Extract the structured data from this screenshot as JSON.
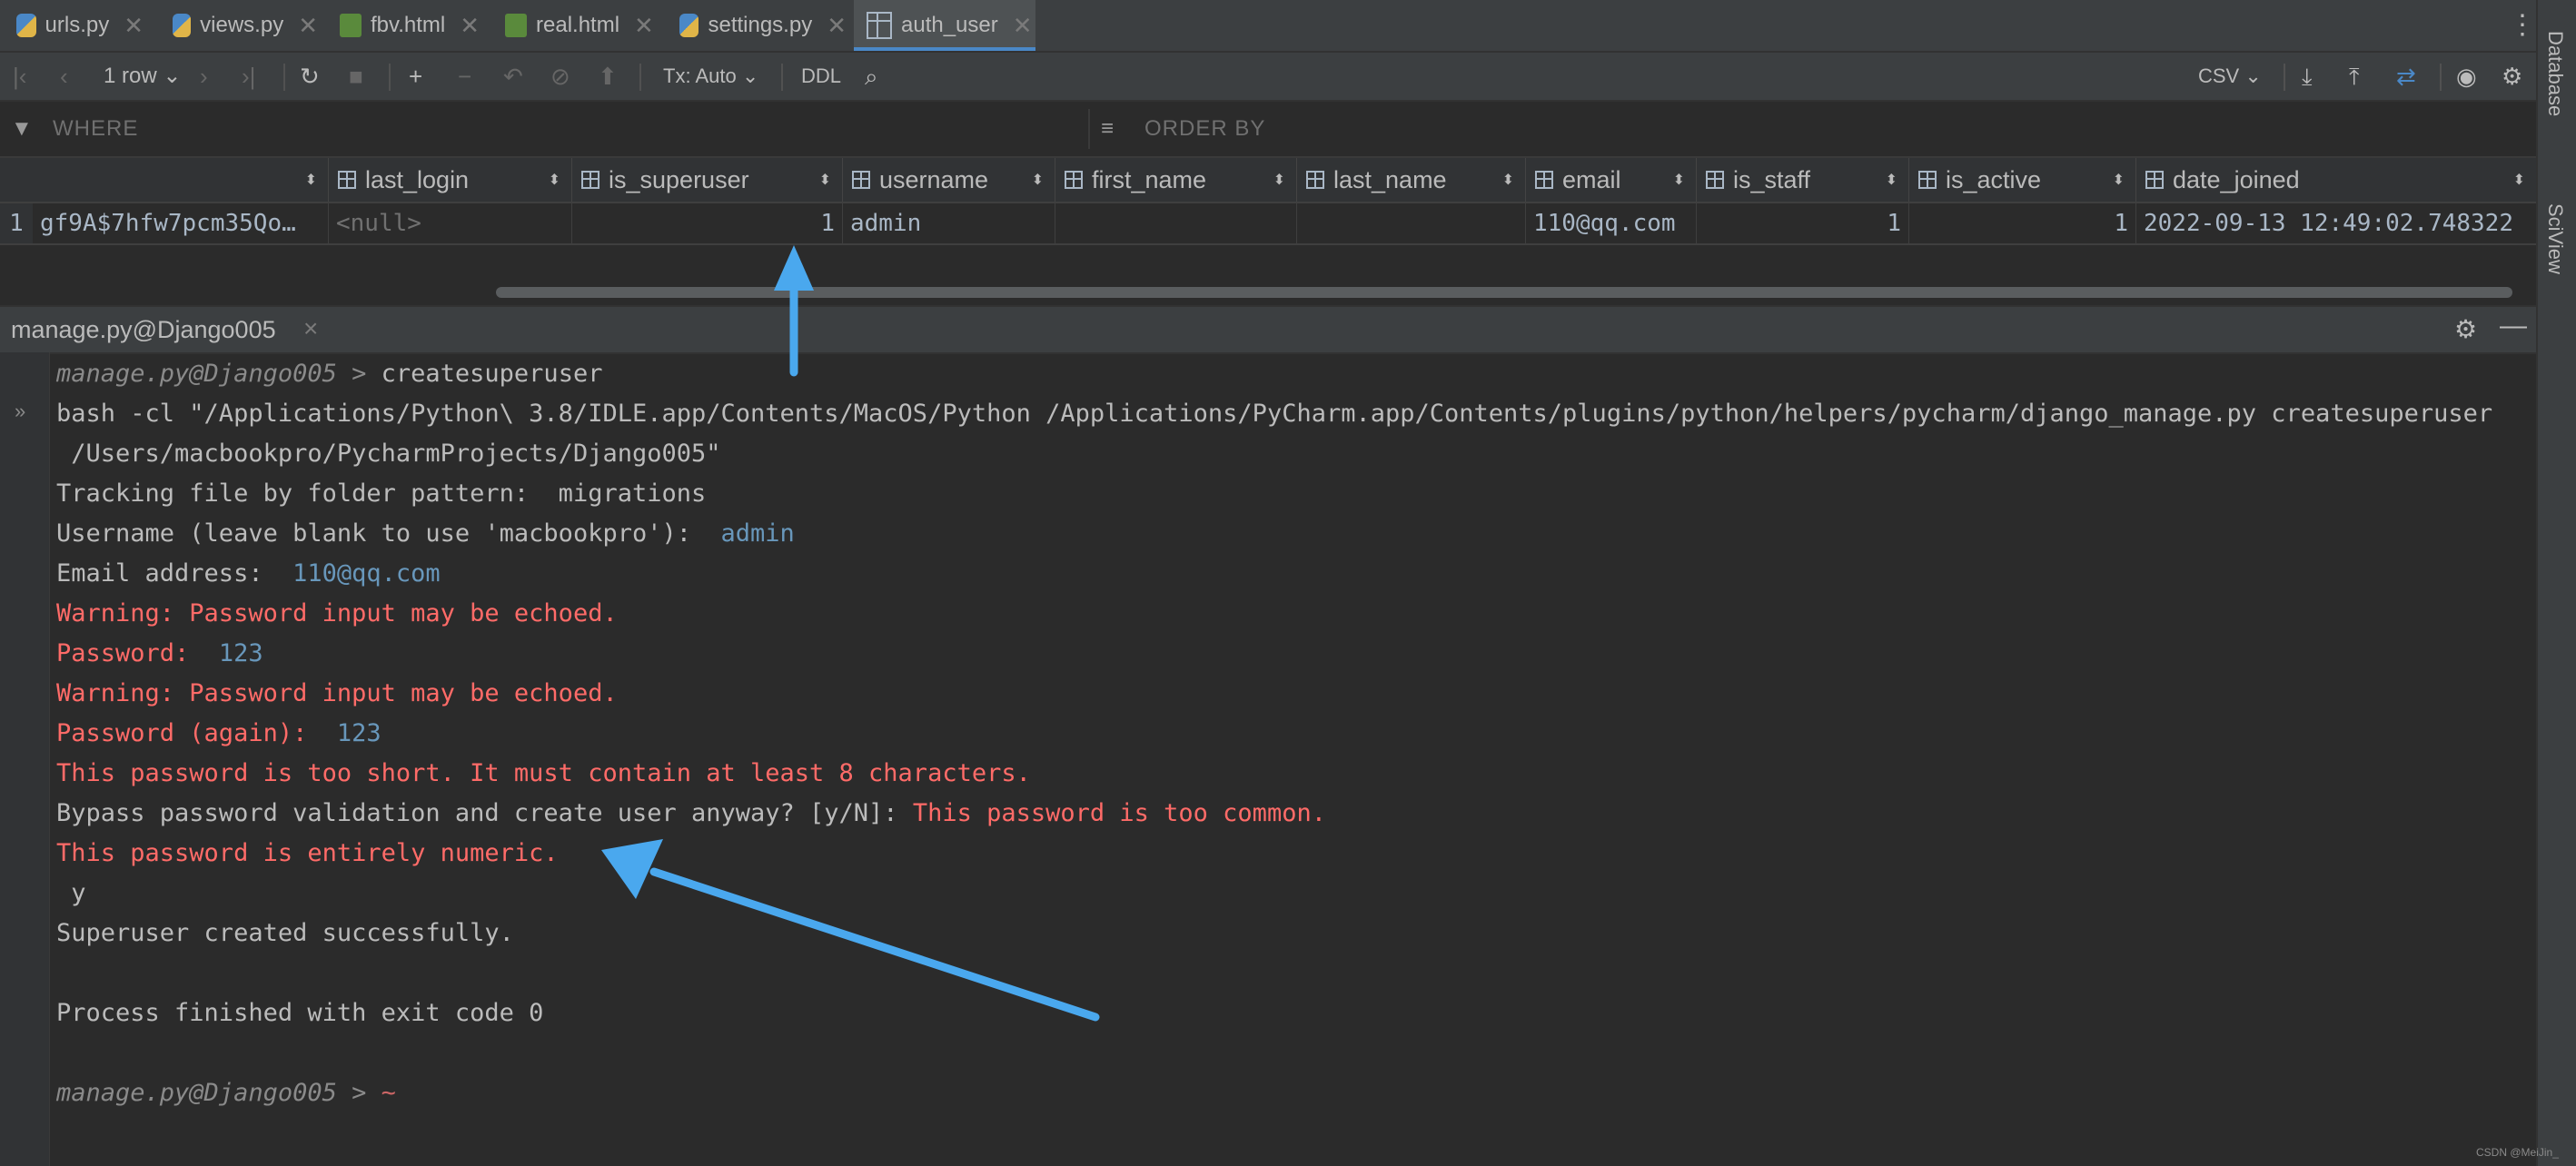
{
  "tabs": [
    {
      "label": "urls.py",
      "icon": "python-file-icon"
    },
    {
      "label": "views.py",
      "icon": "python-file-icon"
    },
    {
      "label": "fbv.html",
      "icon": "html-file-icon"
    },
    {
      "label": "real.html",
      "icon": "html-file-icon"
    },
    {
      "label": "settings.py",
      "icon": "python-file-icon"
    },
    {
      "label": "auth_user",
      "icon": "table-icon",
      "active": true
    }
  ],
  "toolbar": {
    "rows_label": "1 row",
    "tx_label": "Tx: Auto",
    "ddl_label": "DDL",
    "export_label": "CSV"
  },
  "filter": {
    "where_label": "WHERE",
    "order_label": "ORDER BY"
  },
  "grid": {
    "columns": [
      "last_login",
      "is_superuser",
      "username",
      "first_name",
      "last_name",
      "email",
      "is_staff",
      "is_active",
      "date_joined"
    ],
    "row_number": "1",
    "row": {
      "password": "gf9A$7hfw7pcm35Qo…",
      "last_login": "<null>",
      "is_superuser": "1",
      "username": "admin",
      "first_name": "",
      "last_name": "",
      "email": "110@qq.com",
      "is_staff": "1",
      "is_active": "1",
      "date_joined": "2022-09-13 12:49:02.748322"
    }
  },
  "run_panel": {
    "title": "manage.py@Django005"
  },
  "console": {
    "prompt1": "manage.py@Django005 > ",
    "cmd1": "createsuperuser",
    "bash1": "bash -cl \"/Applications/Python\\ 3.8/IDLE.app/Contents/MacOS/Python /Applications/PyCharm.app/Contents/plugins/python/helpers/pycharm/django_manage.py createsuperuser",
    "bash2": " /Users/macbookpro/PycharmProjects/Django005\"",
    "tracking": "Tracking file by folder pattern:  migrations",
    "username_prompt": "Username (leave blank to use 'macbookpro'):  ",
    "username_val": "admin",
    "email_prompt": "Email address:  ",
    "email_num": "110",
    "email_rest": "@qq.com",
    "warn1": "Warning: Password input may be echoed.",
    "pw_prompt": "Password:  ",
    "pw_val": "123",
    "warn2": "Warning: Password input may be echoed.",
    "pw2_prompt": "Password (again):  ",
    "pw2_val": "123",
    "too_short": "This password is too short. It must contain at least 8 characters.",
    "bypass": "Bypass password validation and create user anyway? [y/N]: ",
    "too_common": "This password is too common.",
    "numeric": "This password is entirely numeric.",
    "answer": " y",
    "created": "Superuser created successfully.",
    "finished": "Process finished with exit code 0",
    "prompt2": "manage.py@Django005 > "
  },
  "sidebar": {
    "database_label": "Database",
    "sciview_label": "SciView"
  },
  "watermark": "CSDN @MeiJin_",
  "colors": {
    "accent": "#4a88c7",
    "error": "#ff6b68",
    "number": "#6897bb",
    "arrow": "#4aa8ee"
  }
}
